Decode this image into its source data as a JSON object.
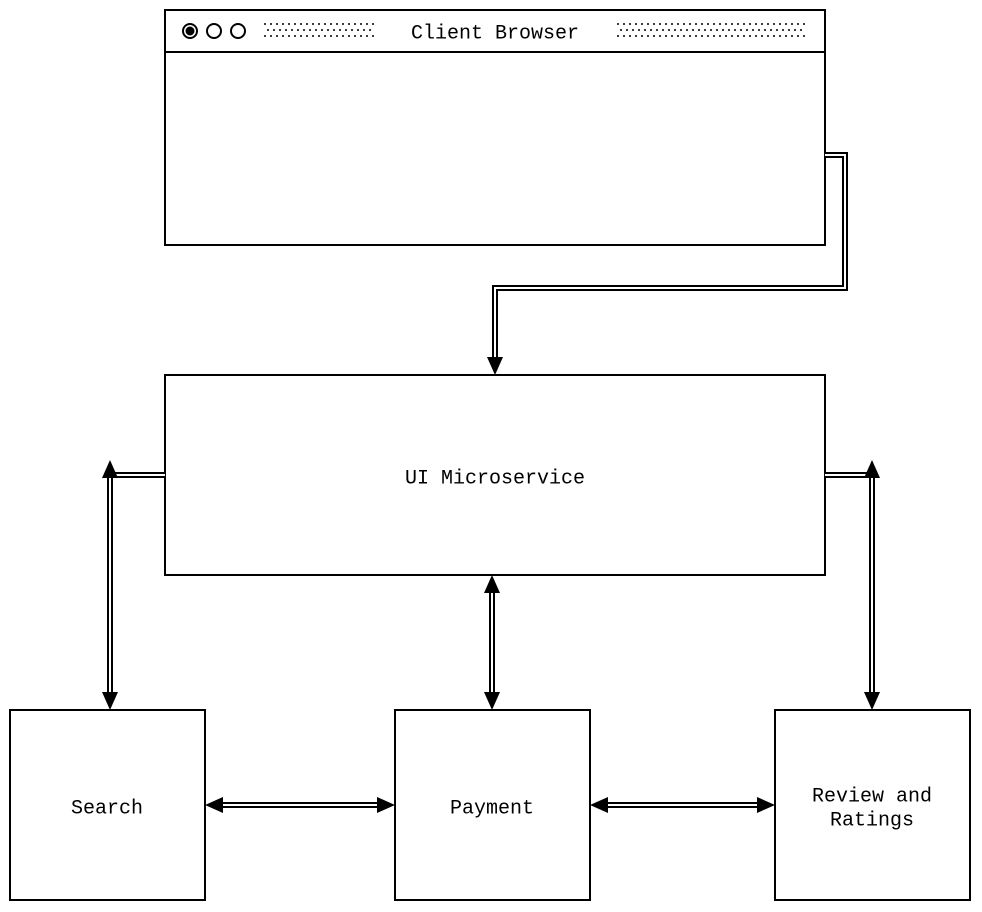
{
  "nodes": {
    "browser": {
      "label": "Client Browser"
    },
    "ui": {
      "label": "UI Microservice"
    },
    "search": {
      "label": "Search"
    },
    "payment": {
      "label": "Payment"
    },
    "reviews_line1": "Review and",
    "reviews_line2": "Ratings"
  },
  "edges": [
    {
      "from": "browser",
      "to": "ui",
      "dir": "uni"
    },
    {
      "from": "ui",
      "to": "search",
      "dir": "bi"
    },
    {
      "from": "ui",
      "to": "payment",
      "dir": "bi"
    },
    {
      "from": "ui",
      "to": "reviews",
      "dir": "bi"
    },
    {
      "from": "search",
      "to": "payment",
      "dir": "bi"
    },
    {
      "from": "payment",
      "to": "reviews",
      "dir": "bi"
    }
  ]
}
